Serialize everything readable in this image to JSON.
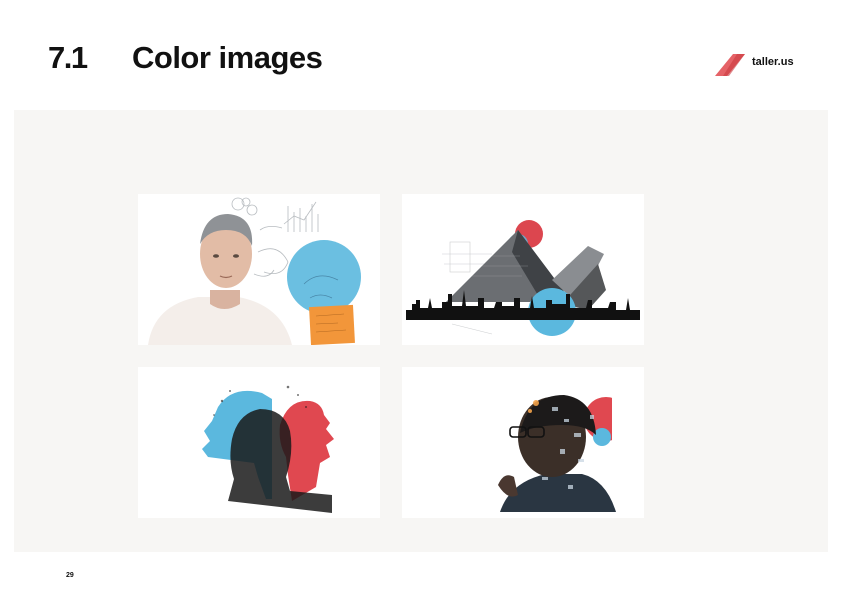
{
  "header": {
    "section_number": "7.1",
    "section_title": "Color images"
  },
  "brand": {
    "name": "taller.us",
    "accent_color": "#e0474c"
  },
  "colors": {
    "panel_background": "#f7f6f4",
    "blue": "#5bb8de",
    "red": "#e04850",
    "orange": "#f2963a"
  },
  "images": [
    {
      "icon": "portrait-man-sketch-collage-image"
    },
    {
      "icon": "architecture-skyline-collage-image"
    },
    {
      "icon": "double-profile-silhouette-image"
    },
    {
      "icon": "tech-overlay-portrait-image"
    }
  ],
  "footer": {
    "page_number": "29"
  }
}
